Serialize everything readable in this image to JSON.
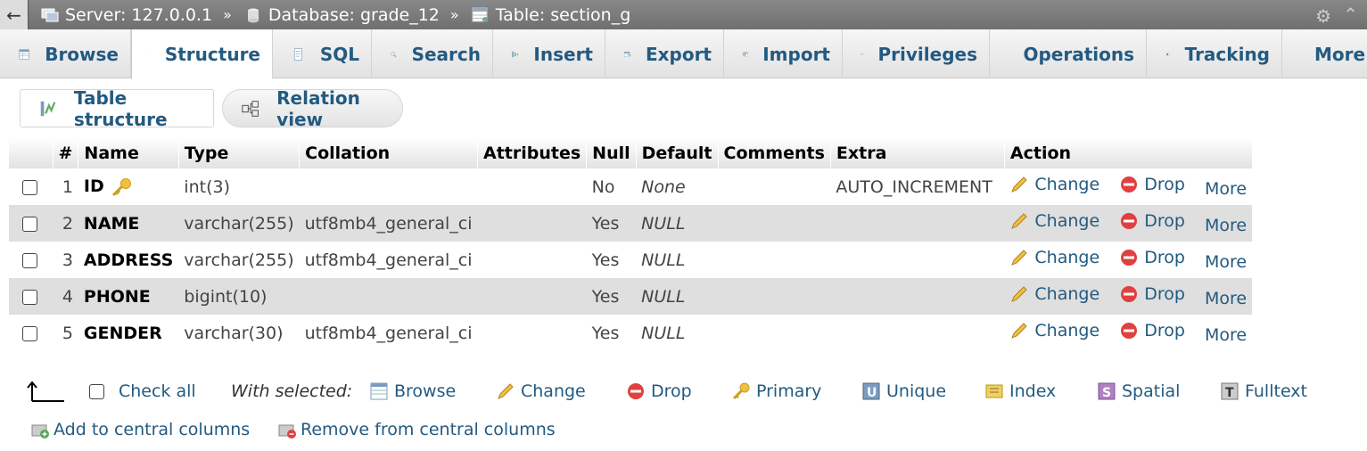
{
  "breadcrumb": {
    "server": "Server: 127.0.0.1",
    "database": "Database: grade_12",
    "table": "Table: section_g",
    "separator": "»"
  },
  "tabs": [
    {
      "label": "Browse",
      "icon": "browse-icon"
    },
    {
      "label": "Structure",
      "icon": "structure-icon",
      "active": true
    },
    {
      "label": "SQL",
      "icon": "sql-icon"
    },
    {
      "label": "Search",
      "icon": "search-icon"
    },
    {
      "label": "Insert",
      "icon": "insert-icon"
    },
    {
      "label": "Export",
      "icon": "export-icon"
    },
    {
      "label": "Import",
      "icon": "import-icon"
    },
    {
      "label": "Privileges",
      "icon": "privileges-icon"
    },
    {
      "label": "Operations",
      "icon": "operations-icon"
    },
    {
      "label": "Tracking",
      "icon": "tracking-icon"
    },
    {
      "label": "More",
      "icon": "dropdown-triangle-icon"
    }
  ],
  "subnav": {
    "table_structure": "Table structure",
    "relation_view": "Relation view"
  },
  "columns": [
    "#",
    "Name",
    "Type",
    "Collation",
    "Attributes",
    "Null",
    "Default",
    "Comments",
    "Extra",
    "Action"
  ],
  "rows": [
    {
      "num": "1",
      "name": "ID",
      "primary": true,
      "type": "int(3)",
      "collation": "",
      "attributes": "",
      "null": "No",
      "default": "None",
      "comments": "",
      "extra": "AUTO_INCREMENT"
    },
    {
      "num": "2",
      "name": "NAME",
      "type": "varchar(255)",
      "collation": "utf8mb4_general_ci",
      "attributes": "",
      "null": "Yes",
      "default": "NULL",
      "comments": "",
      "extra": ""
    },
    {
      "num": "3",
      "name": "ADDRESS",
      "type": "varchar(255)",
      "collation": "utf8mb4_general_ci",
      "attributes": "",
      "null": "Yes",
      "default": "NULL",
      "comments": "",
      "extra": ""
    },
    {
      "num": "4",
      "name": "PHONE",
      "type": "bigint(10)",
      "collation": "",
      "attributes": "",
      "null": "Yes",
      "default": "NULL",
      "comments": "",
      "extra": ""
    },
    {
      "num": "5",
      "name": "GENDER",
      "type": "varchar(30)",
      "collation": "utf8mb4_general_ci",
      "attributes": "",
      "null": "Yes",
      "default": "NULL",
      "comments": "",
      "extra": ""
    }
  ],
  "row_actions": {
    "change": "Change",
    "drop": "Drop",
    "more": "More"
  },
  "bulk": {
    "check_all": "Check all",
    "with_selected": "With selected:",
    "browse": "Browse",
    "change": "Change",
    "drop": "Drop",
    "primary": "Primary",
    "unique": "Unique",
    "index": "Index",
    "spatial": "Spatial",
    "fulltext": "Fulltext",
    "add_central": "Add to central columns",
    "remove_central": "Remove from central columns"
  },
  "colors": {
    "link": "#235a81",
    "row_alt": "#dfdfdf",
    "topbar": "#7a7a7a"
  }
}
